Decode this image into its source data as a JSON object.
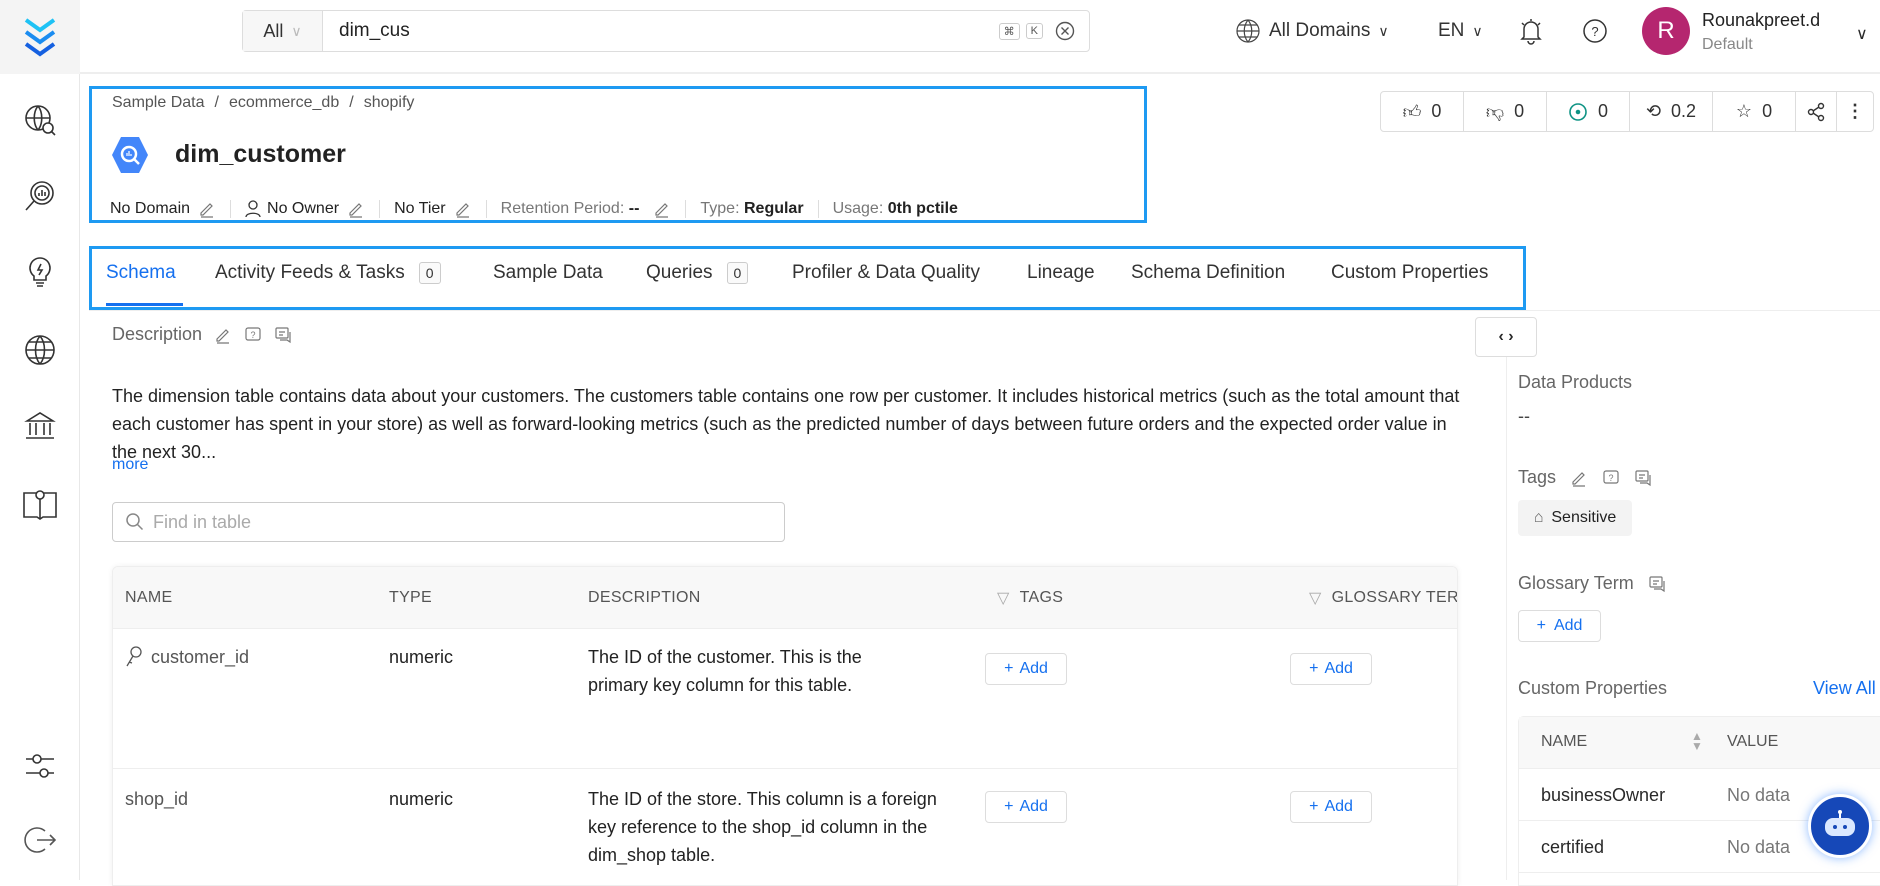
{
  "search": {
    "scope": "All",
    "query": "dim_cus",
    "shortcut_cmd": "⌘",
    "shortcut_key": "K"
  },
  "topbar": {
    "domains": "All Domains",
    "language": "EN",
    "user_initial": "R",
    "user_name": "Rounakpreet.d",
    "user_role": "Default",
    "avatar_color": "#b5266f"
  },
  "breadcrumb": [
    "Sample Data",
    "ecommerce_db",
    "shopify"
  ],
  "entity": {
    "title": "dim_customer",
    "meta": {
      "domain": "No Domain",
      "owner": "No Owner",
      "tier": "No Tier",
      "retention_label": "Retention Period:",
      "retention_value": "--",
      "type_label": "Type:",
      "type_value": "Regular",
      "usage_label": "Usage:",
      "usage_value": "0th pctile"
    }
  },
  "actions": {
    "upvotes": "0",
    "downvotes": "0",
    "followers": "0",
    "version": "0.2",
    "stars": "0"
  },
  "tabs": [
    {
      "label": "Schema"
    },
    {
      "label": "Activity Feeds & Tasks",
      "count": "0"
    },
    {
      "label": "Sample Data"
    },
    {
      "label": "Queries",
      "count": "0"
    },
    {
      "label": "Profiler & Data Quality"
    },
    {
      "label": "Lineage"
    },
    {
      "label": "Schema Definition"
    },
    {
      "label": "Custom Properties"
    }
  ],
  "description": {
    "heading": "Description",
    "text": "The dimension table contains data about your customers. The customers table contains one row per customer. It includes historical metrics (such as the total amount that each customer has spent in your store) as well as forward-looking metrics (such as the predicted number of days between future orders and the expected order value in the next 30...",
    "more": "more"
  },
  "find": {
    "placeholder": "Find in table"
  },
  "table": {
    "columns": [
      "NAME",
      "TYPE",
      "DESCRIPTION",
      "TAGS",
      "GLOSSARY TERMS"
    ],
    "rows": [
      {
        "name": "customer_id",
        "type": "numeric",
        "description": "The ID of the customer. This is the primary key column for this table.",
        "add": "Add"
      },
      {
        "name": "shop_id",
        "type": "numeric",
        "description": "The ID of the store. This column is a foreign key reference to the shop_id column in the dim_shop table.",
        "add": "Add"
      }
    ]
  },
  "right_panel": {
    "data_products": "Data Products",
    "data_products_value": "--",
    "tags": "Tags",
    "tag_chip": "Sensitive",
    "glossary": "Glossary Term",
    "add": "Add",
    "custom_properties": "Custom Properties",
    "view_all": "View All",
    "cp_columns": [
      "NAME",
      "VALUE"
    ],
    "cp_rows": [
      {
        "name": "businessOwner",
        "value": "No data"
      },
      {
        "name": "certified",
        "value": "No data"
      }
    ]
  },
  "colors": {
    "accent": "#1570ef",
    "highlight": "#1e9af2"
  }
}
